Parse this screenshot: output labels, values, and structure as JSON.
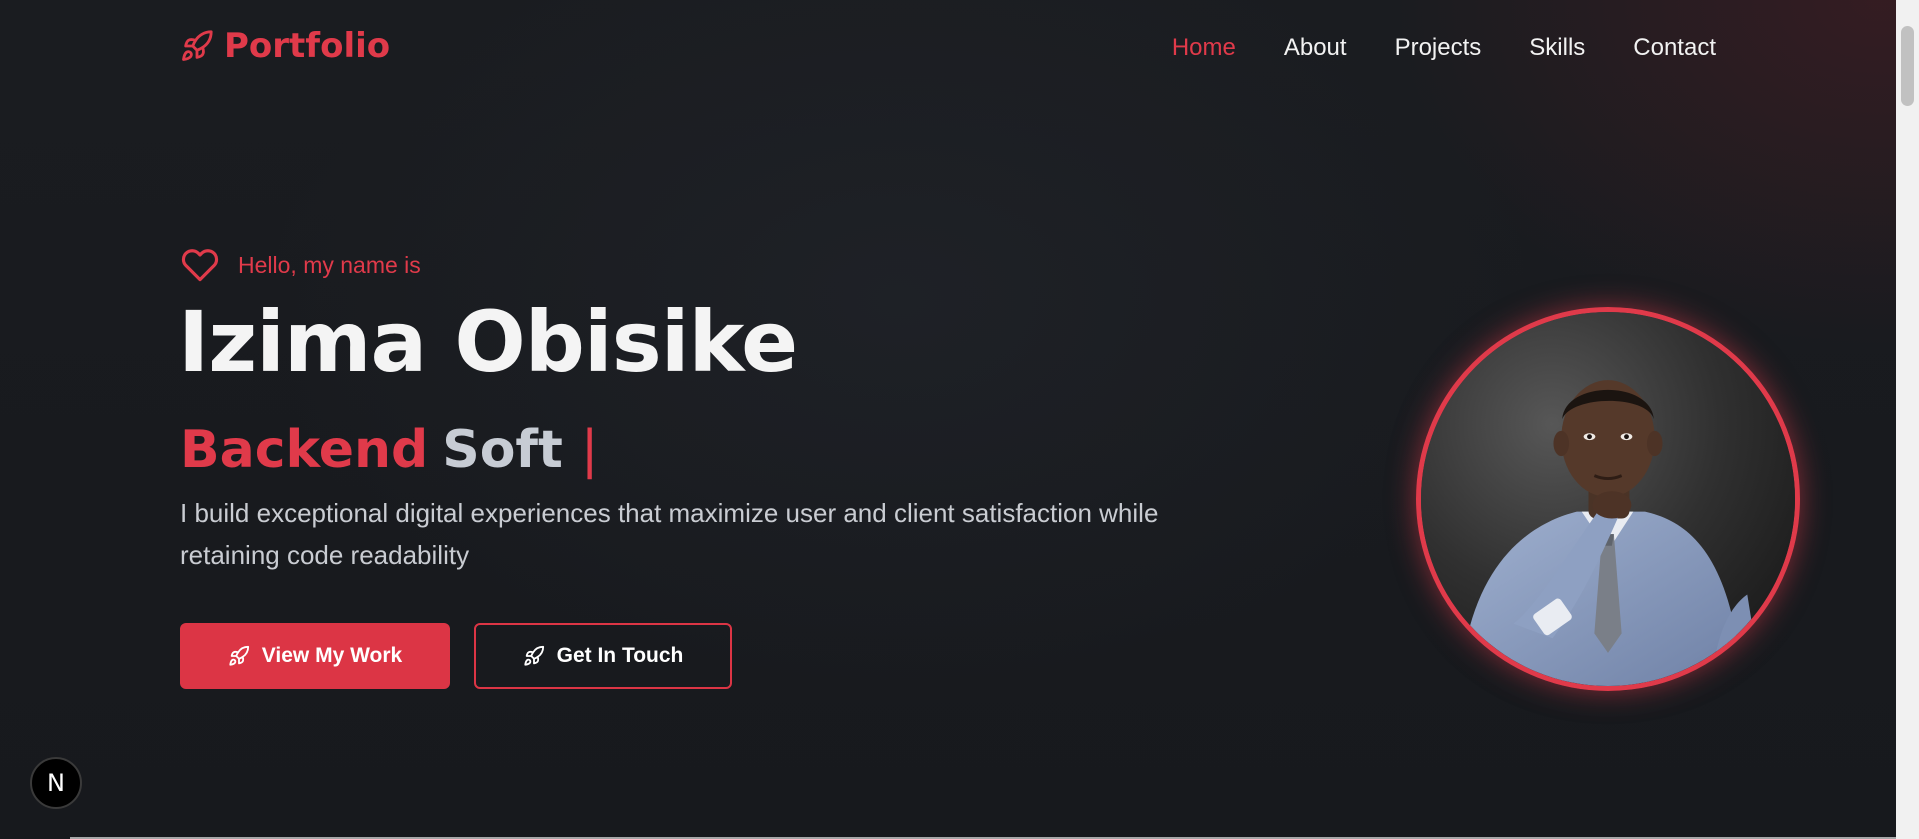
{
  "navbar": {
    "brand": "Portfolio",
    "brand_icon": "rocket-icon",
    "links": [
      {
        "label": "Home",
        "active": true
      },
      {
        "label": "About",
        "active": false
      },
      {
        "label": "Projects",
        "active": false
      },
      {
        "label": "Skills",
        "active": false
      },
      {
        "label": "Contact",
        "active": false
      }
    ]
  },
  "hero": {
    "greeting_icon": "heart-icon",
    "greeting": "Hello, my name is",
    "name": "Izima Obisike",
    "role_primary": "Backend",
    "role_secondary": "Soft",
    "caret": "|",
    "tagline": "I build exceptional digital experiences that maximize user and client satisfaction while retaining code readability",
    "buttons": {
      "primary_label": "View My Work",
      "secondary_label": "Get In Touch",
      "icon": "rocket-icon"
    },
    "portrait_icon": "profile-photo"
  },
  "next_badge": {
    "label": "N"
  },
  "colors": {
    "accent": "#e03a4a",
    "background": "#17191d",
    "text": "#f4f4f4",
    "muted_text": "#c9ccd2"
  }
}
